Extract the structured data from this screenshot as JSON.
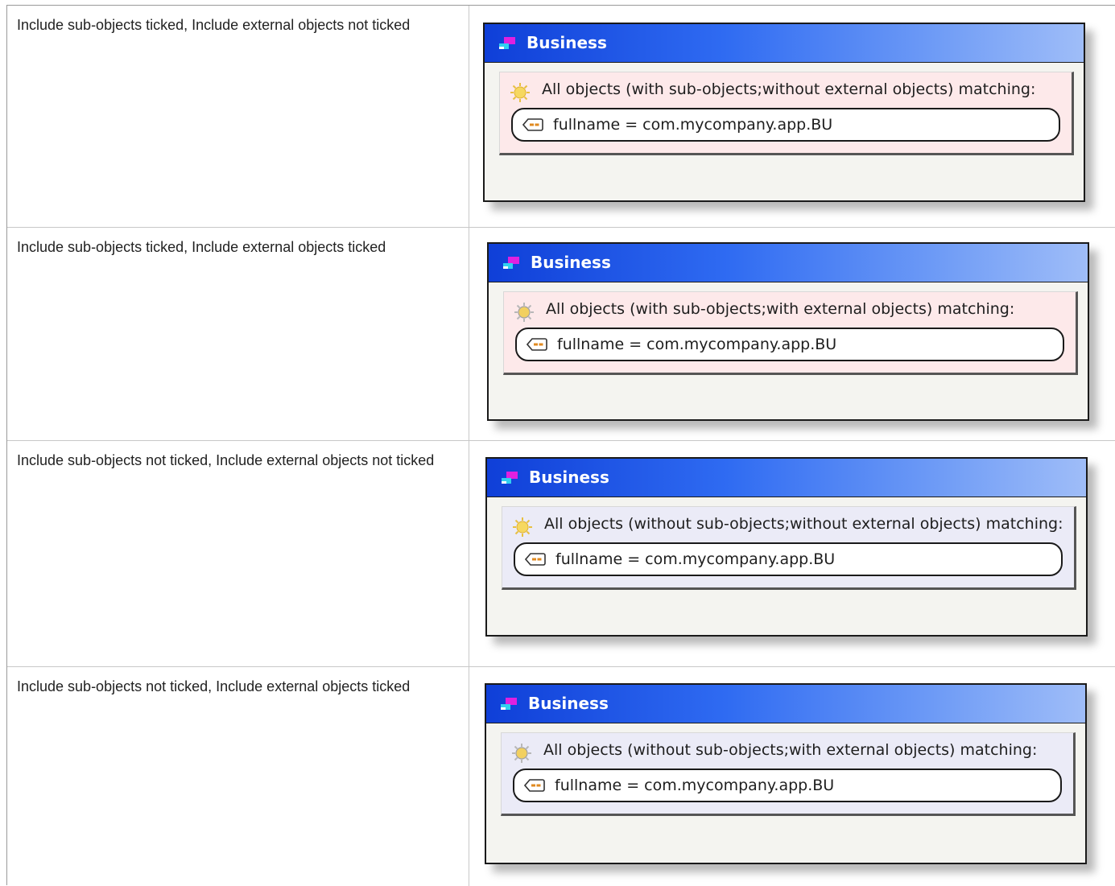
{
  "rows": [
    {
      "label": "Include sub-objects ticked, Include external objects not ticked",
      "figure": {
        "title": "Business",
        "query_text": "All objects (with sub-objects;without external objects) matching:",
        "condition": "fullname = com.mycompany.app.BU",
        "panel_color": "#fde9ea",
        "icon": "sun-icon"
      }
    },
    {
      "label": "Include sub-objects ticked, Include external objects ticked",
      "figure": {
        "title": "Business",
        "query_text": "All objects (with sub-objects;with external objects) matching:",
        "condition": "fullname = com.mycompany.app.BU",
        "panel_color": "#fde9ea",
        "icon": "gear-sun-icon"
      }
    },
    {
      "label": "Include sub-objects not ticked, Include external objects not ticked",
      "figure": {
        "title": "Business",
        "query_text": "All objects (without sub-objects;without external objects) matching:",
        "condition": "fullname = com.mycompany.app.BU",
        "panel_color": "#ebebf7",
        "icon": "sun-icon"
      }
    },
    {
      "label": "Include sub-objects not ticked, Include external objects ticked",
      "figure": {
        "title": "Business",
        "query_text": "All objects (without sub-objects;with external objects) matching:",
        "condition": "fullname = com.mycompany.app.BU",
        "panel_color": "#ebebf7",
        "icon": "gear-sun-icon"
      }
    }
  ],
  "colors": {
    "title_bar_start": "#0f3fd8",
    "title_bar_end": "#9fbdf8",
    "title_text": "#ffffff",
    "border": "#1a1a1a"
  }
}
